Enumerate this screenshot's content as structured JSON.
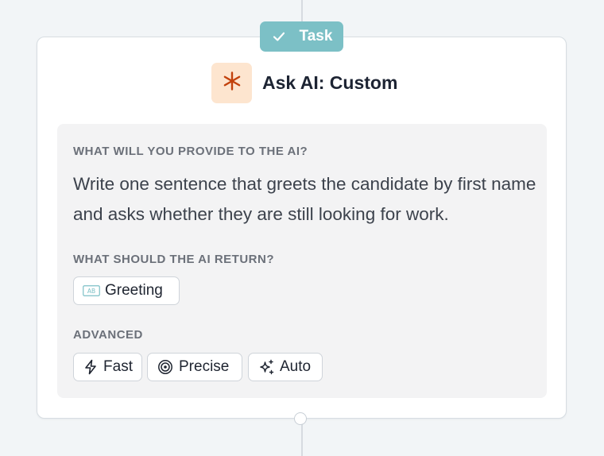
{
  "badge": {
    "label": "Task",
    "icon": "check-icon"
  },
  "node": {
    "title": "Ask AI: Custom",
    "icon": "asterisk-icon",
    "icon_color": "#c2410c",
    "icon_bg": "#fde5cf"
  },
  "provide": {
    "label": "WHAT WILL YOU PROVIDE TO THE AI?",
    "text": "Write one sentence that greets the candidate by first name and asks whether they are still looking for work."
  },
  "returns": {
    "label": "WHAT SHOULD THE AI RETURN?",
    "items": [
      {
        "label": "Greeting",
        "icon": "text-field-icon",
        "icon_text": "AB"
      }
    ]
  },
  "advanced": {
    "label": "ADVANCED",
    "options": [
      {
        "label": "Fast",
        "icon": "lightning-icon"
      },
      {
        "label": "Precise",
        "icon": "target-icon"
      },
      {
        "label": "Auto",
        "icon": "sparkles-icon"
      }
    ]
  },
  "colors": {
    "badge": "#7cc0c6",
    "background": "#f2f5f7",
    "panel": "#f3f3f4"
  }
}
